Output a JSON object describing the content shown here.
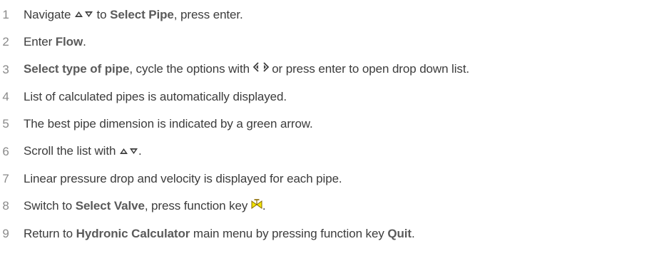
{
  "steps": [
    {
      "num": "1",
      "parts": [
        {
          "t": "text",
          "v": "Navigate "
        },
        {
          "t": "icon",
          "icon": "up-down-arrows-icon"
        },
        {
          "t": "text",
          "v": " to "
        },
        {
          "t": "bold",
          "v": "Select Pipe"
        },
        {
          "t": "text",
          "v": ", press enter."
        }
      ]
    },
    {
      "num": "2",
      "parts": [
        {
          "t": "text",
          "v": "Enter "
        },
        {
          "t": "bold",
          "v": "Flow"
        },
        {
          "t": "text",
          "v": "."
        }
      ]
    },
    {
      "num": "3",
      "parts": [
        {
          "t": "bold",
          "v": "Select type of pipe"
        },
        {
          "t": "text",
          "v": ", cycle the options with "
        },
        {
          "t": "icon",
          "icon": "left-right-arrows-icon"
        },
        {
          "t": "text",
          "v": " or press enter to open drop down list."
        }
      ]
    },
    {
      "num": "4",
      "parts": [
        {
          "t": "text",
          "v": "List of calculated pipes is automatically displayed."
        }
      ]
    },
    {
      "num": "5",
      "parts": [
        {
          "t": "text",
          "v": "The best pipe dimension is indicated by a green arrow."
        }
      ]
    },
    {
      "num": "6",
      "parts": [
        {
          "t": "text",
          "v": "Scroll the list with "
        },
        {
          "t": "icon",
          "icon": "up-down-arrows-icon"
        },
        {
          "t": "text",
          "v": "."
        }
      ]
    },
    {
      "num": "7",
      "parts": [
        {
          "t": "text",
          "v": "Linear pressure drop and velocity is displayed for each pipe."
        }
      ]
    },
    {
      "num": "8",
      "parts": [
        {
          "t": "text",
          "v": "Switch to "
        },
        {
          "t": "bold",
          "v": "Select Valve"
        },
        {
          "t": "text",
          "v": ", press function key "
        },
        {
          "t": "icon",
          "icon": "valve-icon"
        },
        {
          "t": "text",
          "v": "."
        }
      ]
    },
    {
      "num": "9",
      "parts": [
        {
          "t": "text",
          "v": "Return to "
        },
        {
          "t": "bold",
          "v": "Hydronic Calculator"
        },
        {
          "t": "text",
          "v": " main menu by pressing function key "
        },
        {
          "t": "bold",
          "v": "Quit"
        },
        {
          "t": "text",
          "v": "."
        }
      ]
    }
  ],
  "colors": {
    "text": "#3c3c3c",
    "number": "#8a8a8a",
    "icon": "#3c3c3c",
    "valve_fill": "#f2e600",
    "valve_stroke": "#8a6a00"
  }
}
